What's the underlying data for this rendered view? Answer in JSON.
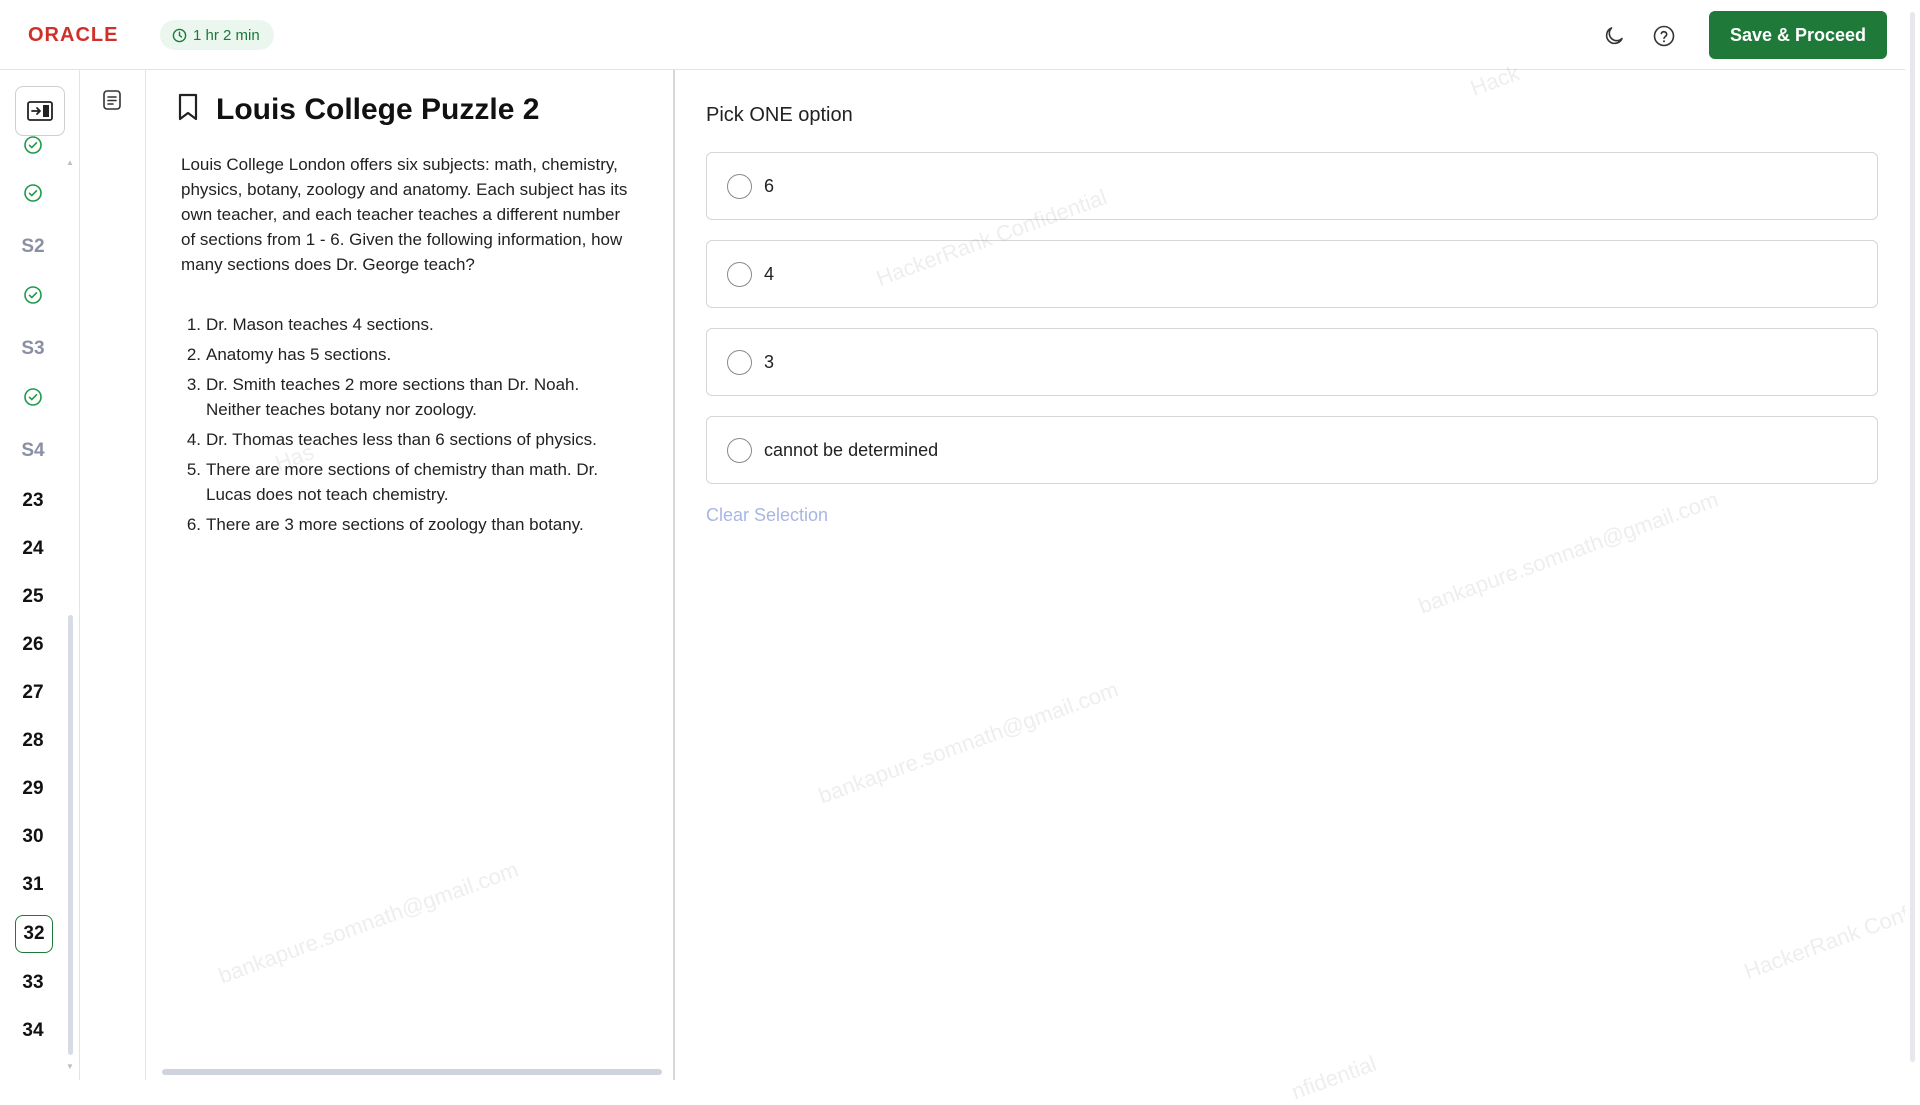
{
  "header": {
    "logo": "ORACLE",
    "timer": "1 hr 2 min",
    "save_label": "Save & Proceed"
  },
  "rail": {
    "items": [
      {
        "type": "done"
      },
      {
        "type": "done"
      },
      {
        "type": "section",
        "label": "S2"
      },
      {
        "type": "done"
      },
      {
        "type": "section",
        "label": "S3"
      },
      {
        "type": "done"
      },
      {
        "type": "section",
        "label": "S4"
      },
      {
        "type": "number",
        "label": "23"
      },
      {
        "type": "number",
        "label": "24"
      },
      {
        "type": "number",
        "label": "25"
      },
      {
        "type": "number",
        "label": "26"
      },
      {
        "type": "number",
        "label": "27"
      },
      {
        "type": "number",
        "label": "28"
      },
      {
        "type": "number",
        "label": "29"
      },
      {
        "type": "number",
        "label": "30"
      },
      {
        "type": "number",
        "label": "31"
      },
      {
        "type": "current",
        "label": "32"
      },
      {
        "type": "number",
        "label": "33"
      },
      {
        "type": "number",
        "label": "34"
      }
    ]
  },
  "question": {
    "title": "Louis College Puzzle 2",
    "body": "Louis College London offers six subjects: math, chemistry, physics, botany, zoology and anatomy. Each subject has its own teacher, and each teacher teaches a different number of sections from 1 - 6. Given the following information, how many sections does Dr. George teach?",
    "clues": [
      {
        "num": "1.",
        "text": "Dr. Mason teaches 4 sections."
      },
      {
        "num": "2.",
        "text": "Anatomy has 5 sections."
      },
      {
        "num": "3.",
        "text": "Dr. Smith teaches 2 more sections than Dr. Noah. Neither teaches botany nor zoology."
      },
      {
        "num": "4.",
        "text": "Dr. Thomas teaches less than 6 sections of physics."
      },
      {
        "num": "5.",
        "text": "There are more sections of chemistry than math. Dr. Lucas does not teach chemistry."
      },
      {
        "num": "6.",
        "text": "There are 3 more sections of zoology than botany."
      }
    ]
  },
  "answers": {
    "prompt": "Pick ONE option",
    "options": [
      "6",
      "4",
      "3",
      "cannot be determined"
    ],
    "clear_label": "Clear Selection"
  },
  "watermarks": [
    "HackerRank Confidential",
    "bankapure.somnath@gmail.com",
    "bankapure.somnath@gmail.com",
    "bankapure.somnath@gmail.com",
    "HackerRank Conf",
    "Hack",
    "nfidential",
    "Has"
  ],
  "colors": {
    "brand_red": "#d0302a",
    "primary_green": "#1f7a3a",
    "timer_bg": "#ebf6ee",
    "clear_link": "#a8b6e3"
  }
}
